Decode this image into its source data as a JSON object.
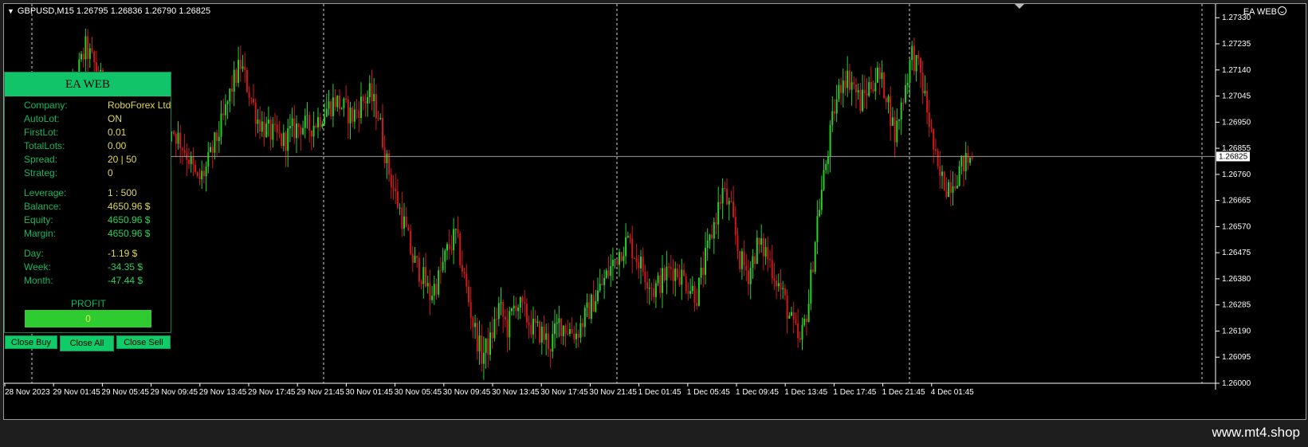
{
  "header": {
    "symbol_info": "GBPUSD,M15  1.26795 1.26836 1.26790 1.26825"
  },
  "indicator_label": "EA WEB",
  "icons": {
    "dropdown": "triangle-down-icon",
    "smile": "smile-icon"
  },
  "colors": {
    "bull": "#28d02a",
    "bear": "#d01818",
    "background": "#000000",
    "panel_header": "#11c46a"
  },
  "ea_panel": {
    "title": "EA WEB",
    "rows": [
      {
        "label": "Company:",
        "value": "RoboForex Ltd"
      },
      {
        "label": "AutoLot:",
        "value": "ON"
      },
      {
        "label": "FirstLot:",
        "value": "0.01"
      },
      {
        "label": "TotalLots:",
        "value": "0.00"
      },
      {
        "label": "Spread:",
        "value": "20  |  50"
      },
      {
        "label": "Strateg:",
        "value": "0"
      },
      {
        "label": "Leverage:",
        "value": "1 : 500"
      },
      {
        "label": "Balance:",
        "value": "4650.96 $"
      },
      {
        "label": "Equity:",
        "value": "4650.96 $"
      },
      {
        "label": "Margin:",
        "value": "4650.96 $"
      },
      {
        "label": "Day:",
        "value": "-1.19 $"
      },
      {
        "label": "Week:",
        "value": "-34.35 $"
      },
      {
        "label": "Month:",
        "value": "-47.44 $"
      }
    ],
    "profit_label": "PROFIT",
    "profit_value": "0",
    "buttons": {
      "close_buy": "Close Buy",
      "close_all": "Close All",
      "close_sell": "Close Sell"
    }
  },
  "chart_data": {
    "type": "candlestick",
    "symbol": "GBPUSD",
    "timeframe": "M15",
    "ylim": [
      1.26,
      1.2738
    ],
    "price_ticks": [
      "1.27330",
      "1.27235",
      "1.27140",
      "1.27045",
      "1.26950",
      "1.26855",
      "1.26760",
      "1.26665",
      "1.26570",
      "1.26475",
      "1.26380",
      "1.26285",
      "1.26190",
      "1.26095",
      "1.26000"
    ],
    "current_price": "1.26825",
    "time_ticks": [
      "28 Nov 2023",
      "29 Nov 01:45",
      "29 Nov 05:45",
      "29 Nov 09:45",
      "29 Nov 13:45",
      "29 Nov 17:45",
      "29 Nov 21:45",
      "30 Nov 01:45",
      "30 Nov 05:45",
      "30 Nov 09:45",
      "30 Nov 13:45",
      "30 Nov 17:45",
      "30 Nov 21:45",
      "1 Dec 01:45",
      "1 Dec 05:45",
      "1 Dec 09:45",
      "1 Dec 13:45",
      "1 Dec 17:45",
      "1 Dec 21:45",
      "4 Dec 01:45"
    ],
    "day_separators": [
      "29 Nov",
      "30 Nov",
      "1 Dec",
      "4 Dec"
    ],
    "close_path": [
      [
        0,
        1.2693
      ],
      [
        4,
        1.27
      ],
      [
        8,
        1.2712
      ],
      [
        12,
        1.2722
      ],
      [
        16,
        1.2716
      ],
      [
        20,
        1.2708
      ],
      [
        24,
        1.2697
      ],
      [
        28,
        1.2686
      ],
      [
        32,
        1.268
      ],
      [
        36,
        1.2675
      ],
      [
        40,
        1.268
      ],
      [
        44,
        1.2684
      ],
      [
        48,
        1.2688
      ],
      [
        52,
        1.2693
      ],
      [
        56,
        1.2688
      ],
      [
        60,
        1.2682
      ],
      [
        64,
        1.2673
      ],
      [
        68,
        1.2678
      ],
      [
        72,
        1.2687
      ],
      [
        76,
        1.2696
      ],
      [
        80,
        1.2708
      ],
      [
        84,
        1.2716
      ],
      [
        88,
        1.2706
      ],
      [
        92,
        1.2696
      ],
      [
        96,
        1.2692
      ],
      [
        100,
        1.269
      ],
      [
        104,
        1.2688
      ],
      [
        108,
        1.2692
      ],
      [
        112,
        1.2694
      ],
      [
        116,
        1.2693
      ],
      [
        120,
        1.2696
      ],
      [
        124,
        1.27
      ],
      [
        128,
        1.2703
      ],
      [
        132,
        1.27
      ],
      [
        136,
        1.2697
      ],
      [
        140,
        1.2702
      ],
      [
        144,
        1.2705
      ],
      [
        148,
        1.2698
      ],
      [
        152,
        1.268
      ],
      [
        156,
        1.2668
      ],
      [
        160,
        1.2658
      ],
      [
        164,
        1.2645
      ],
      [
        168,
        1.264
      ],
      [
        172,
        1.2632
      ],
      [
        176,
        1.2638
      ],
      [
        180,
        1.2648
      ],
      [
        184,
        1.2654
      ],
      [
        188,
        1.2638
      ],
      [
        192,
        1.2622
      ],
      [
        196,
        1.261
      ],
      [
        200,
        1.2615
      ],
      [
        204,
        1.2628
      ],
      [
        208,
        1.262
      ],
      [
        212,
        1.263
      ],
      [
        216,
        1.2625
      ],
      [
        220,
        1.262
      ],
      [
        224,
        1.2618
      ],
      [
        228,
        1.2614
      ],
      [
        232,
        1.2622
      ],
      [
        236,
        1.262
      ],
      [
        240,
        1.2618
      ],
      [
        244,
        1.2624
      ],
      [
        248,
        1.263
      ],
      [
        252,
        1.2636
      ],
      [
        256,
        1.2642
      ],
      [
        260,
        1.2648
      ],
      [
        264,
        1.2652
      ],
      [
        268,
        1.2646
      ],
      [
        272,
        1.264
      ],
      [
        276,
        1.2634
      ],
      [
        280,
        1.2638
      ],
      [
        284,
        1.2642
      ],
      [
        288,
        1.264
      ],
      [
        292,
        1.2636
      ],
      [
        296,
        1.2632
      ],
      [
        300,
        1.2645
      ],
      [
        304,
        1.2658
      ],
      [
        308,
        1.267
      ],
      [
        312,
        1.2662
      ],
      [
        316,
        1.2645
      ],
      [
        320,
        1.264
      ],
      [
        324,
        1.265
      ],
      [
        328,
        1.2648
      ],
      [
        332,
        1.264
      ],
      [
        336,
        1.2632
      ],
      [
        340,
        1.2622
      ],
      [
        344,
        1.2614
      ],
      [
        348,
        1.263
      ],
      [
        352,
        1.266
      ],
      [
        356,
        1.268
      ],
      [
        360,
        1.27
      ],
      [
        364,
        1.2712
      ],
      [
        368,
        1.271
      ],
      [
        372,
        1.2702
      ],
      [
        376,
        1.2708
      ],
      [
        380,
        1.2712
      ],
      [
        384,
        1.2706
      ],
      [
        388,
        1.269
      ],
      [
        392,
        1.2705
      ],
      [
        396,
        1.272
      ],
      [
        400,
        1.2712
      ],
      [
        404,
        1.2695
      ],
      [
        408,
        1.2676
      ],
      [
        412,
        1.2672
      ],
      [
        416,
        1.2675
      ],
      [
        420,
        1.268
      ],
      [
        424,
        1.2682
      ]
    ]
  },
  "watermark": "www.mt4.shop"
}
